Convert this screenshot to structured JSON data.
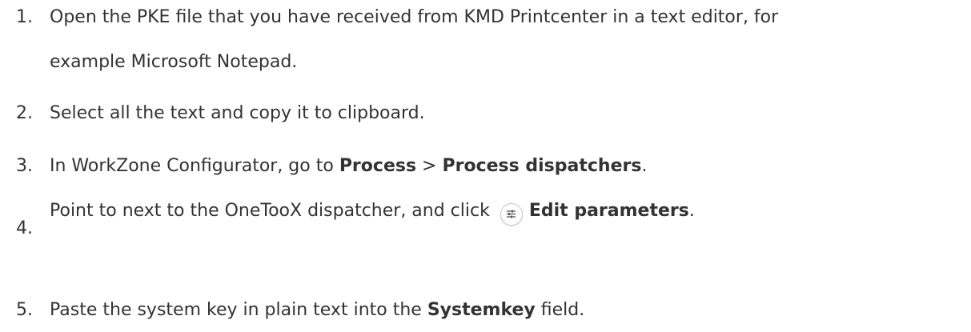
{
  "steps": [
    {
      "number": "1.",
      "line1": "Open the PKE file that you have received from KMD Printcenter in a text editor, for",
      "line2": "example Microsoft Notepad."
    },
    {
      "number": "2.",
      "text": "Select all the text and copy it to clipboard."
    },
    {
      "number": "3.",
      "prefix": "In WorkZone Configurator, go to ",
      "bold1": "Process",
      "sep": " > ",
      "bold2": "Process dispatchers",
      "suffix": "."
    },
    {
      "number": "4.",
      "prefix": "Point to next to the OneTooX dispatcher, and click ",
      "icon": "edit-parameters-icon",
      "bold": "Edit parameters",
      "suffix": "."
    },
    {
      "number": "5.",
      "prefix": "Paste the system key in plain text into the ",
      "bold": "Systemkey",
      "suffix": " field."
    }
  ]
}
